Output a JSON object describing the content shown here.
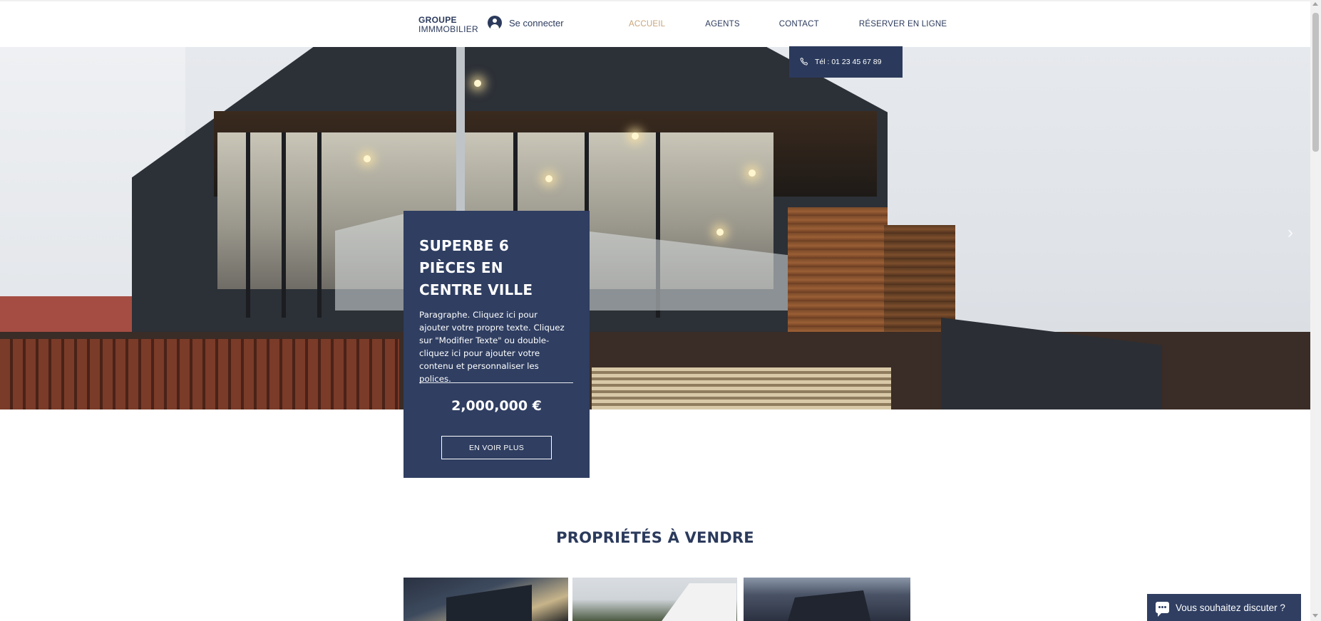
{
  "header": {
    "logo_line1": "GROUPE",
    "logo_line2": "IMMMOBILIER",
    "login_label": "Se connecter",
    "nav": [
      {
        "label": "ACCUEIL",
        "active": true
      },
      {
        "label": "AGENTS",
        "active": false
      },
      {
        "label": "CONTACT",
        "active": false
      },
      {
        "label": "RÉSERVER EN LIGNE",
        "active": false
      }
    ]
  },
  "phone": {
    "label": "Tél : 01 23 45 67 89"
  },
  "feature": {
    "title": "SUPERBE 6 PIÈCES EN CENTRE VILLE",
    "paragraph": "Paragraphe. Cliquez ici pour ajouter votre propre texte. Cliquez sur \"Modifier Texte\" ou double-cliquez ici pour ajouter votre contenu et personnaliser les polices.",
    "price": "2,000,000 €",
    "button_label": "EN VOIR PLUS"
  },
  "section": {
    "title": "PROPRIÉTÉS À VENDRE"
  },
  "chat": {
    "label": "Vous souhaitez discuter ?"
  },
  "colors": {
    "primary": "#2f3e61",
    "nav_text": "#2b3a5c",
    "accent": "#c9a57b"
  },
  "icons": [
    "user-avatar-icon",
    "phone-icon",
    "chevron-right-icon",
    "chat-icon"
  ]
}
